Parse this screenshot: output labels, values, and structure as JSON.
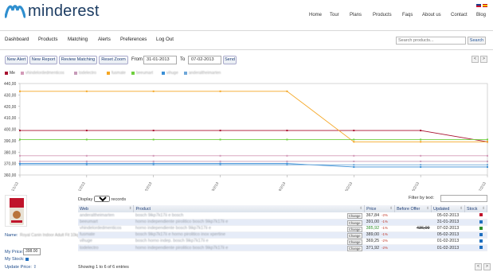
{
  "header": {
    "logo_text": "minderest",
    "nav": [
      "Home",
      "Tour",
      "Plans",
      "Products",
      "Faqs",
      "About us",
      "Contact",
      "Blog"
    ]
  },
  "menu": {
    "items": [
      "Dashboard",
      "Products",
      "Matching",
      "Alerts",
      "Preferences",
      "Log Out"
    ],
    "search_placeholder": "Search products...",
    "search_button": "Search"
  },
  "toolbar": {
    "buttons": [
      "New Alert",
      "New Report",
      "Review Matching",
      "Reset Zoom"
    ],
    "from_label": "From",
    "from_value": "31-01-2013",
    "to_label": "To",
    "to_value": "07-02-2013",
    "send": "Send",
    "prev": "<",
    "next": ">"
  },
  "legend": [
    {
      "name": "Me",
      "color": "#a8112f"
    },
    {
      "name": "vhindelordedmenticos",
      "color": "#d39ab8"
    },
    {
      "name": "todelectro",
      "color": "#c79bb9"
    },
    {
      "name": "fusmate",
      "color": "#f5a623"
    },
    {
      "name": "beeumart",
      "color": "#6fcf3e"
    },
    {
      "name": "vihuge",
      "color": "#3a8fd6"
    },
    {
      "name": "anderaltheimarten",
      "color": "#6fa7d8"
    }
  ],
  "chart_data": {
    "type": "line",
    "x": [
      "31/1/13",
      "1/2/13",
      "2/2/13",
      "3/2/13",
      "4/2/13",
      "5/2/13",
      "6/2/13",
      "7/2/13"
    ],
    "ylim": [
      360,
      440
    ],
    "yticks": [
      "440,00",
      "430,00",
      "420,00",
      "410,00",
      "400,00",
      "390,00",
      "380,00",
      "370,00",
      "360,00"
    ],
    "series": [
      {
        "name": "Me",
        "color": "#a8112f",
        "values": [
          398.9,
          398.9,
          398.9,
          398.9,
          398.9,
          398.9,
          398.9,
          389.0
        ]
      },
      {
        "name": "vhindelordedmenticos",
        "color": "#d39ab8",
        "values": [
          376.8,
          376.8,
          376.8,
          376.8,
          376.8,
          376.8,
          376.8,
          376.8
        ]
      },
      {
        "name": "todelectro",
        "color": "#c79bb9",
        "values": [
          371.9,
          371.9,
          371.9,
          371.9,
          371.9,
          371.9,
          371.9,
          371.9
        ]
      },
      {
        "name": "fusmate",
        "color": "#f5a623",
        "values": [
          433.2,
          433.2,
          433.2,
          433.2,
          433.2,
          389.0,
          389.0,
          389.0
        ]
      },
      {
        "name": "beeumart",
        "color": "#6fcf3e",
        "values": [
          391.0,
          391.0,
          391.0,
          391.0,
          391.0,
          391.0,
          391.0,
          391.0
        ]
      },
      {
        "name": "vihuge",
        "color": "#3a8fd6",
        "values": [
          370.0,
          370.0,
          370.0,
          370.0,
          370.0,
          367.0,
          367.0,
          367.0
        ]
      },
      {
        "name": "anderaltheimarten",
        "color": "#6fa7d8",
        "values": [
          368.9,
          368.9,
          368.9,
          368.9,
          368.9,
          368.9,
          368.9,
          368.9
        ]
      }
    ]
  },
  "product": {
    "name_label": "Name:",
    "name_value": "Royal Canin Indoor Adult Fit 10kg",
    "price_label": "My Price:",
    "price_value": "398.00",
    "stock_label": "My Stock:",
    "update_label": "Update Price:"
  },
  "table": {
    "display_label": "Display",
    "display_value": "15",
    "records_label": "records",
    "filter_label": "Filter by text:",
    "headers": [
      "Web",
      "Product",
      "Price",
      "Before Offer",
      "Updated",
      "Stock"
    ],
    "change_label": "Change",
    "rows": [
      {
        "web": "anderaltheimarten",
        "product": "bosch 9ikp7k17ii e bosch",
        "price": "367,84",
        "pct": "-2%",
        "before": "",
        "updated": "05-02-2013",
        "stock_color": "#c0102a"
      },
      {
        "web": "beeumart",
        "product": "horno independiente pirolitico bosch 9ikp7k17ii e",
        "price": "391,00",
        "pct": "-1%",
        "before": "",
        "updated": "31-01-2013",
        "stock_color": "#1f6fbf"
      },
      {
        "web": "vhindelordedmenticos",
        "product": "horno independiente bosch 9ikp7k17ii e",
        "price": "385,92",
        "pct": "-1%",
        "before": "436,09",
        "updated": "07-02-2013",
        "stock_color": "#2d8f2d"
      },
      {
        "web": "fusmate",
        "product": "bosch 9ikp7k17ii e horno pirolitico inox xpertine",
        "price": "389,00",
        "pct": "-1%",
        "before": "",
        "updated": "05-02-2013",
        "stock_color": "#1f6fbf"
      },
      {
        "web": "vihuge",
        "product": "bosch horno indep. bosch 9ikp7k17ii e",
        "price": "369,25",
        "pct": "-2%",
        "before": "",
        "updated": "01-02-2013",
        "stock_color": "#1f6fbf"
      },
      {
        "web": "todelectro",
        "product": "horno independiente pirolitico bosch 9ikp7k17ii e",
        "price": "371,92",
        "pct": "-2%",
        "before": "",
        "updated": "01-02-2013",
        "stock_color": "#1f6fbf"
      }
    ],
    "showing": "Showing 1 to 6 of 6 entries"
  }
}
